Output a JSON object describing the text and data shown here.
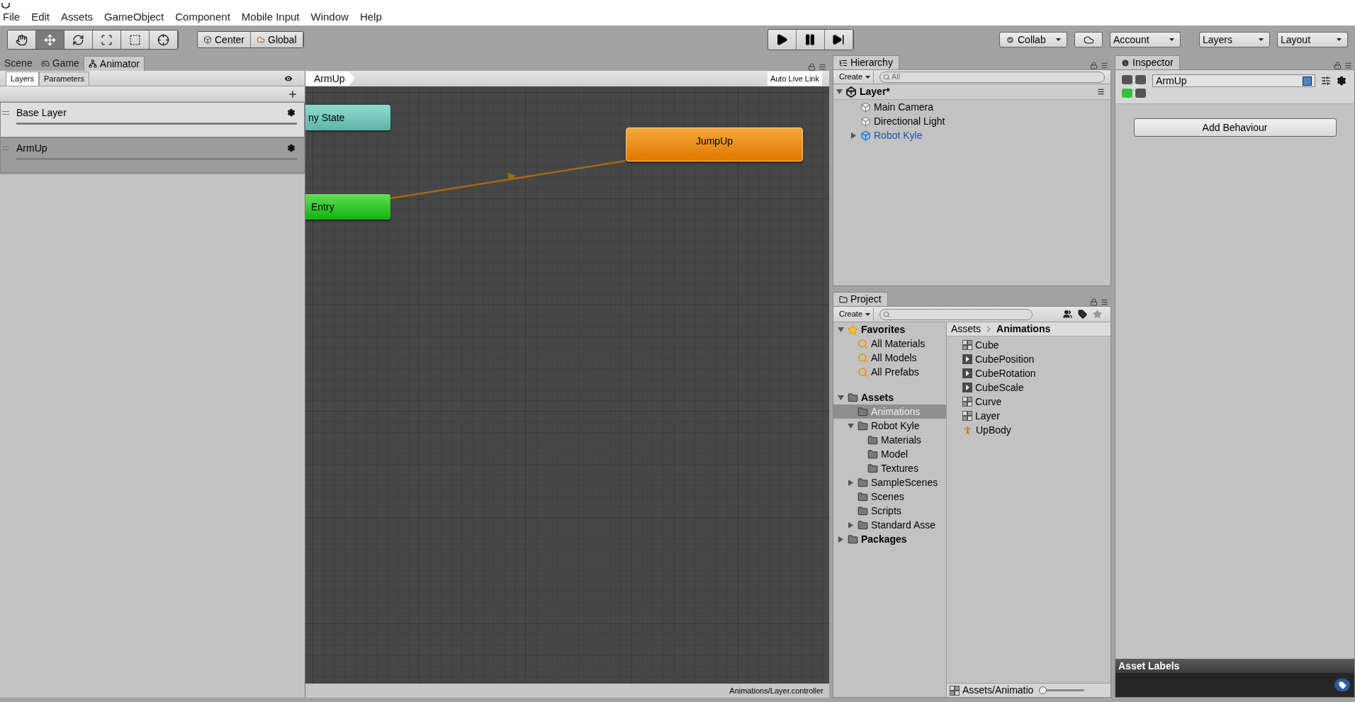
{
  "menu": [
    "File",
    "Edit",
    "Assets",
    "GameObject",
    "Component",
    "Mobile Input",
    "Window",
    "Help"
  ],
  "toolbar": {
    "tools": [
      {
        "kind": "hand",
        "selected": false
      },
      {
        "kind": "move",
        "selected": true
      },
      {
        "kind": "rotate",
        "selected": false
      },
      {
        "kind": "scale",
        "selected": false
      },
      {
        "kind": "rect",
        "selected": false
      },
      {
        "kind": "transform",
        "selected": false
      }
    ],
    "pivot": [
      "Center",
      "Global"
    ],
    "play": [
      {
        "kind": "play"
      },
      {
        "kind": "pause"
      },
      {
        "kind": "step"
      }
    ],
    "collab": "Collab",
    "account": "Account",
    "layers": "Layers",
    "layout": "Layout"
  },
  "left_tabs": [
    {
      "label": "Scene",
      "kind": "scene",
      "selected": false
    },
    {
      "label": "Game",
      "kind": "game",
      "selected": false
    },
    {
      "label": "Animator",
      "kind": "animator",
      "selected": true
    }
  ],
  "animator": {
    "tabs": [
      {
        "label": "Layers",
        "selected": true
      },
      {
        "label": "Parameters",
        "selected": false
      }
    ],
    "layers": [
      {
        "name": "Base Layer",
        "selected": false
      },
      {
        "name": "ArmUp",
        "selected": true
      }
    ],
    "breadcrumb": "ArmUp",
    "auto_live_link": "Auto Live Link",
    "nodes": [
      {
        "label": "ny State",
        "kind": "any"
      },
      {
        "label": "Entry",
        "kind": "entry"
      },
      {
        "label": "JumpUp",
        "kind": "default"
      }
    ],
    "status": "Animations/Layer.controller"
  },
  "hierarchy": {
    "tab": "Hierarchy",
    "create": "Create",
    "search_placeholder": "All",
    "scene": "Layer*",
    "items": [
      {
        "name": "Main Camera",
        "kind": "object"
      },
      {
        "name": "Directional Light",
        "kind": "object"
      },
      {
        "name": "Robot Kyle",
        "kind": "prefab",
        "expanded": false
      }
    ]
  },
  "project": {
    "tab": "Project",
    "create": "Create",
    "tree": [
      {
        "name": "Favorites",
        "kind": "favorites",
        "expanded": true,
        "selected": false,
        "children": [
          {
            "name": "All Materials",
            "kind": "search",
            "selected": false
          },
          {
            "name": "All Models",
            "kind": "search",
            "selected": false
          },
          {
            "name": "All Prefabs",
            "kind": "search",
            "selected": false
          }
        ]
      },
      {
        "name": "Assets",
        "kind": "folder",
        "expanded": true,
        "selected": false,
        "children": [
          {
            "name": "Animations",
            "kind": "folder",
            "selected": true
          },
          {
            "name": "Robot Kyle",
            "kind": "folder",
            "expanded": true,
            "selected": false,
            "children": [
              {
                "name": "Materials",
                "kind": "folder",
                "selected": false
              },
              {
                "name": "Model",
                "kind": "folder",
                "selected": false
              },
              {
                "name": "Textures",
                "kind": "folder",
                "selected": false
              }
            ]
          },
          {
            "name": "SampleScenes",
            "kind": "folder",
            "expanded": false,
            "selected": false
          },
          {
            "name": "Scenes",
            "kind": "folder",
            "selected": false
          },
          {
            "name": "Scripts",
            "kind": "folder",
            "selected": false
          },
          {
            "name": "Standard Asse",
            "kind": "folder",
            "expanded": false,
            "selected": false
          }
        ]
      },
      {
        "name": "Packages",
        "kind": "folder",
        "expanded": false,
        "selected": false
      }
    ],
    "breadcrumb": [
      "Assets",
      "Animations"
    ],
    "files": [
      {
        "name": "Cube",
        "kind": "controller"
      },
      {
        "name": "CubePosition",
        "kind": "clip"
      },
      {
        "name": "CubeRotation",
        "kind": "clip"
      },
      {
        "name": "CubeScale",
        "kind": "clip"
      },
      {
        "name": "Curve",
        "kind": "controller"
      },
      {
        "name": "Layer",
        "kind": "controller"
      },
      {
        "name": "UpBody",
        "kind": "mask"
      }
    ],
    "footer_path": "Assets/Animatio",
    "zoom": {
      "level": 0.0
    }
  },
  "inspector": {
    "tab": "Inspector",
    "name": "ArmUp",
    "add_button": "Add Behaviour",
    "asset_labels": "Asset Labels"
  }
}
